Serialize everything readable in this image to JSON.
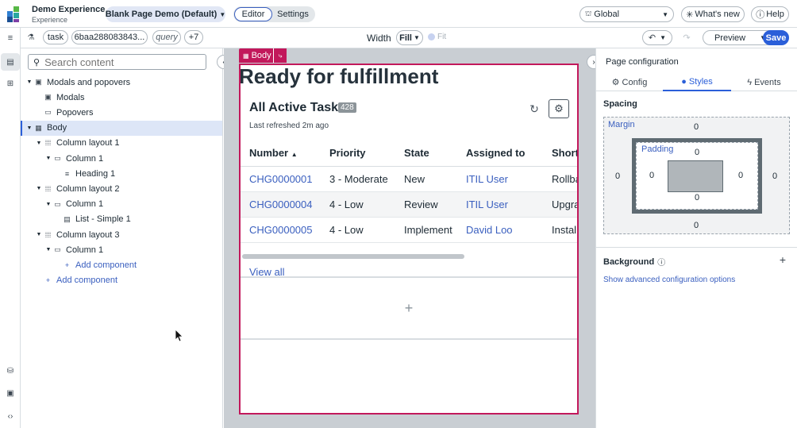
{
  "app": {
    "name": "Demo Experience",
    "subtitle": "Experience",
    "page_selector": "Blank Page Demo (Default)",
    "mode_tabs": [
      "Editor",
      "Settings"
    ],
    "scope": "Global",
    "whats_new": "What's new",
    "help": "Help"
  },
  "toolbar": {
    "chips": [
      "task",
      "6baa288083843...",
      "query",
      "+7"
    ],
    "width_label": "Width",
    "width_value": "Fill",
    "fit_label": "Fit",
    "preview": "Preview",
    "save": "Save"
  },
  "tree": {
    "search_placeholder": "Search content",
    "nodes": [
      {
        "label": "Modals and popovers",
        "icon": "container-icon",
        "level": 0,
        "caret": true
      },
      {
        "label": "Modals",
        "icon": "modal-icon",
        "level": 1,
        "caret": false
      },
      {
        "label": "Popovers",
        "icon": "popover-icon",
        "level": 1,
        "caret": false
      },
      {
        "label": "Body",
        "icon": "body-icon",
        "level": 0,
        "caret": true,
        "selected": true
      },
      {
        "label": "Column layout 1",
        "icon": "columns-icon",
        "level": 1,
        "caret": true
      },
      {
        "label": "Column 1",
        "icon": "column-icon",
        "level": 2,
        "caret": true
      },
      {
        "label": "Heading 1",
        "icon": "heading-icon",
        "level": 3,
        "caret": false
      },
      {
        "label": "Column layout 2",
        "icon": "columns-icon",
        "level": 1,
        "caret": true
      },
      {
        "label": "Column 1",
        "icon": "column-icon",
        "level": 2,
        "caret": true
      },
      {
        "label": "List - Simple 1",
        "icon": "list-icon",
        "level": 3,
        "caret": false
      },
      {
        "label": "Column layout 3",
        "icon": "columns-icon",
        "level": 1,
        "caret": true
      },
      {
        "label": "Column 1",
        "icon": "column-icon",
        "level": 2,
        "caret": true
      },
      {
        "label": "Add component",
        "icon": "plus-icon",
        "level": 3,
        "caret": false,
        "add": true
      },
      {
        "label": "Add component",
        "icon": "plus-icon",
        "level": 1,
        "caret": false,
        "add": true
      }
    ]
  },
  "canvas": {
    "body_tag": "Body",
    "heading": "Ready for fulfillment",
    "list": {
      "title": "All Active Tasks",
      "count": "428",
      "refreshed": "Last refreshed 2m ago",
      "columns": [
        "Number",
        "Priority",
        "State",
        "Assigned to",
        "Short"
      ],
      "sort_indicator": "▲",
      "rows": [
        {
          "number": "CHG0000001",
          "priority": "3 - Moderate",
          "state": "New",
          "assigned": "ITIL User",
          "short": "Rollba"
        },
        {
          "number": "CHG0000004",
          "priority": "4 - Low",
          "state": "Review",
          "assigned": "ITIL User",
          "short": "Upgra"
        },
        {
          "number": "CHG0000005",
          "priority": "4 - Low",
          "state": "Implement",
          "assigned": "David Loo",
          "short": "Install"
        }
      ],
      "view_all": "View all"
    },
    "add_glyph": "+"
  },
  "config": {
    "title": "Page configuration",
    "tabs": [
      "Config",
      "Styles",
      "Events"
    ],
    "active_tab": "Styles",
    "spacing_label": "Spacing",
    "margin_label": "Margin",
    "padding_label": "Padding",
    "margin": {
      "top": "0",
      "right": "0",
      "bottom": "0",
      "left": "0"
    },
    "padding": {
      "top": "0",
      "right": "0",
      "bottom": "0",
      "left": "0"
    },
    "background_label": "Background",
    "advanced_link": "Show advanced configuration options"
  },
  "colors": {
    "accent": "#3a5fbf",
    "save": "#2b5fd9",
    "selection": "#c2185b",
    "tree_selected": "#dde6f7"
  }
}
